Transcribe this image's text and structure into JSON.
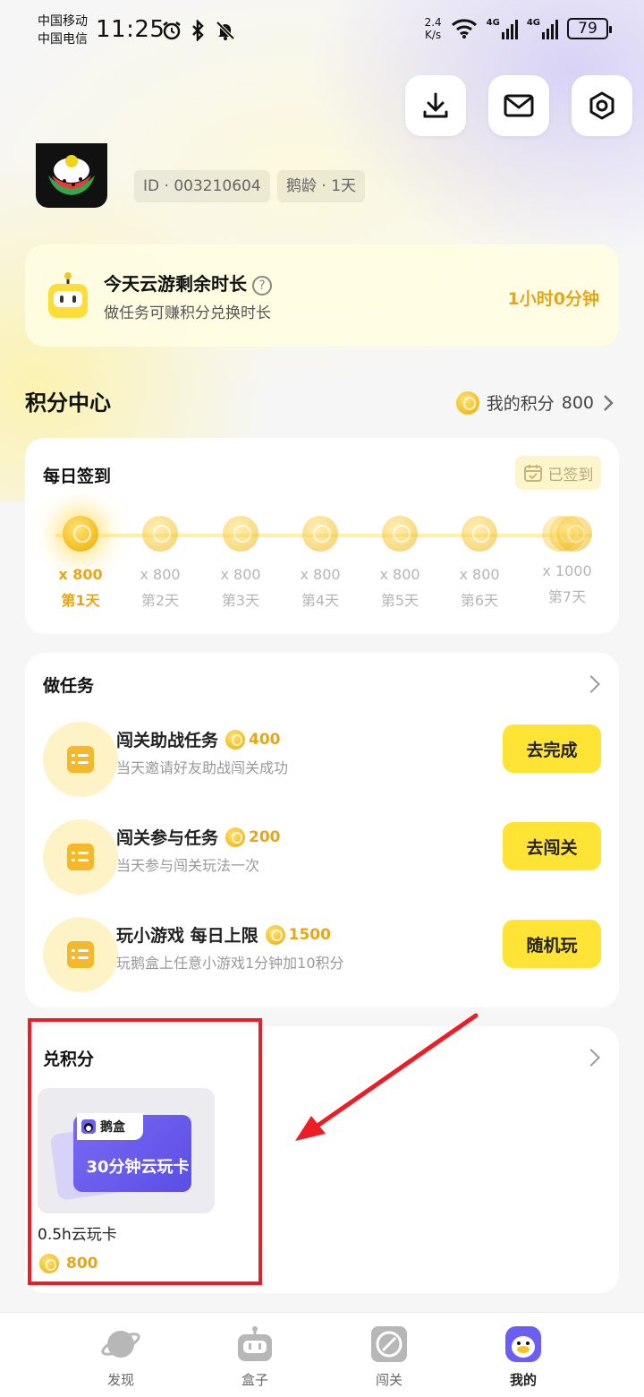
{
  "status_bar": {
    "carrier_1": "中国移动",
    "carrier_2": "中国电信",
    "time": "11:25",
    "net_speed_value": "2.4",
    "net_speed_unit": "K/s",
    "sig_1": "4G",
    "sig_2": "4G",
    "battery": "79"
  },
  "header": {
    "download_icon": "download-icon",
    "mail_icon": "mail-icon",
    "settings_icon": "settings-icon"
  },
  "profile": {
    "id_label": "ID · 003210604",
    "age_label": "鹅龄 · 1天"
  },
  "cloud_time": {
    "title": "今天云游剩余时长",
    "help": "?",
    "subtitle": "做任务可赚积分兑换时长",
    "value": "1小时0分钟"
  },
  "points_center": {
    "title": "积分中心",
    "my_points_label": "我的积分",
    "my_points_value": "800"
  },
  "checkin": {
    "title": "每日签到",
    "status": "已签到",
    "days": [
      {
        "amount": "x 800",
        "label": "第1天"
      },
      {
        "amount": "x 800",
        "label": "第2天"
      },
      {
        "amount": "x 800",
        "label": "第3天"
      },
      {
        "amount": "x 800",
        "label": "第4天"
      },
      {
        "amount": "x 800",
        "label": "第5天"
      },
      {
        "amount": "x 800",
        "label": "第6天"
      },
      {
        "amount": "x 1000",
        "label": "第7天"
      }
    ]
  },
  "tasks": {
    "title": "做任务",
    "items": [
      {
        "name": "闯关助战任务",
        "points": "400",
        "desc": "当天邀请好友助战闯关成功",
        "button": "去完成"
      },
      {
        "name": "闯关参与任务",
        "points": "200",
        "desc": "当天参与闯关玩法一次",
        "button": "去闯关"
      },
      {
        "name": "玩小游戏 每日上限",
        "points": "1500",
        "desc": "玩鹅盒上任意小游戏1分钟加10积分",
        "button": "随机玩"
      }
    ]
  },
  "exchange": {
    "title": "兑积分",
    "item": {
      "brand": "鹅盒",
      "card_text": "30分钟云玩卡",
      "name": "0.5h云玩卡",
      "price": "800"
    }
  },
  "nav": {
    "items": [
      {
        "label": "发现",
        "icon": "planet-icon"
      },
      {
        "label": "盒子",
        "icon": "robot-icon"
      },
      {
        "label": "闯关",
        "icon": "disc-icon"
      },
      {
        "label": "我的",
        "icon": "penguin-icon"
      }
    ],
    "active_index": 3
  },
  "colors": {
    "accent_yellow": "#ffe436",
    "points_orange": "#e7a616",
    "annotation_red": "#ee1c24"
  }
}
